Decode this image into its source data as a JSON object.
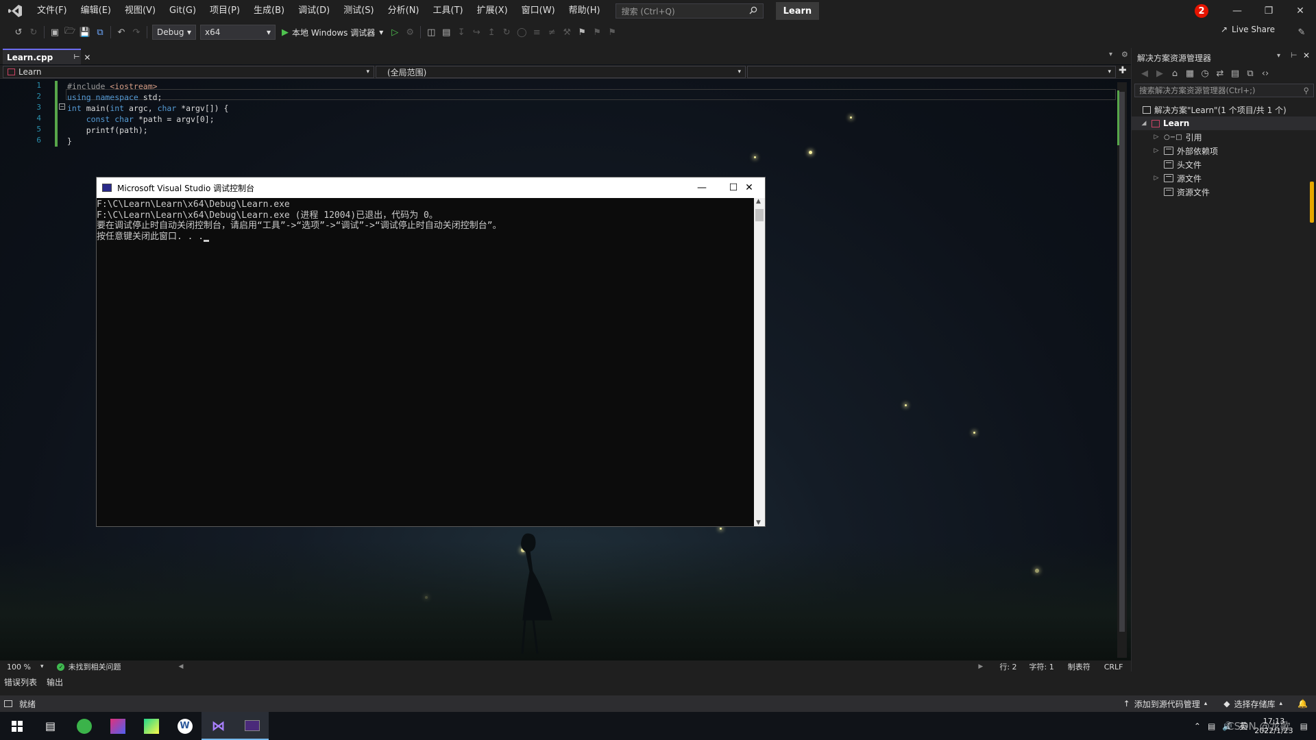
{
  "menubar": {
    "items": [
      "文件(F)",
      "编辑(E)",
      "视图(V)",
      "Git(G)",
      "项目(P)",
      "生成(B)",
      "调试(D)",
      "测试(S)",
      "分析(N)",
      "工具(T)",
      "扩展(X)",
      "窗口(W)",
      "帮助(H)"
    ],
    "search_placeholder": "搜索 (Ctrl+Q)",
    "solution_name": "Learn",
    "notification_count": "2"
  },
  "toolbar": {
    "config": "Debug",
    "platform": "x64",
    "run_label": "本地 Windows 调试器",
    "live_share": "Live Share"
  },
  "editor": {
    "tab_name": "Learn.cpp",
    "nav_project": "Learn",
    "nav_scope": "(全局范围)",
    "line_numbers": [
      "1",
      "2",
      "3",
      "4",
      "5",
      "6"
    ],
    "code": {
      "l1_a": "#include ",
      "l1_b": "<iostream>",
      "l2_a": "using namespace",
      "l2_b": " std;",
      "l3_a": "int",
      "l3_b": " main(",
      "l3_c": "int",
      "l3_d": " argc, ",
      "l3_e": "char",
      "l3_f": " *argv[]) {",
      "l4_a": "    ",
      "l4_b": "const char",
      "l4_c": " *path = argv[0];",
      "l5": "    printf(path);",
      "l6": "}"
    },
    "zoom": "100 %",
    "issues": "未找到相关问题",
    "row": "行: 2",
    "col": "字符: 1",
    "tab_mode": "制表符",
    "line_ending": "CRLF"
  },
  "console": {
    "title": "Microsoft Visual Studio 调试控制台",
    "lines": [
      "F:\\C\\Learn\\Learn\\x64\\Debug\\Learn.exe",
      "F:\\C\\Learn\\Learn\\x64\\Debug\\Learn.exe (进程 12004)已退出，代码为 0。",
      "要在调试停止时自动关闭控制台，请启用“工具”->“选项”->“调试”->“调试停止时自动关闭控制台”。",
      "按任意键关闭此窗口. . ."
    ]
  },
  "solution_explorer": {
    "title": "解决方案资源管理器",
    "search_placeholder": "搜索解决方案资源管理器(Ctrl+;)",
    "solution_label": "解决方案\"Learn\"(1 个项目/共 1 个)",
    "project": "Learn",
    "nodes": [
      "引用",
      "外部依赖项",
      "头文件",
      "源文件",
      "资源文件"
    ]
  },
  "bottom": {
    "tabs": [
      "错误列表",
      "输出"
    ],
    "status_ready": "就绪",
    "add_source_control": "添加到源代码管理",
    "select_repo": "选择存储库"
  },
  "taskbar": {
    "ime": "英",
    "time": "17:13",
    "date": "2022/1/23",
    "watermark": "CSDN @龙歌"
  },
  "colors": {
    "accent": "#6c6cf0",
    "keyword": "#569cd6",
    "change_bar": "#57a64a",
    "badge": "#e51400"
  }
}
